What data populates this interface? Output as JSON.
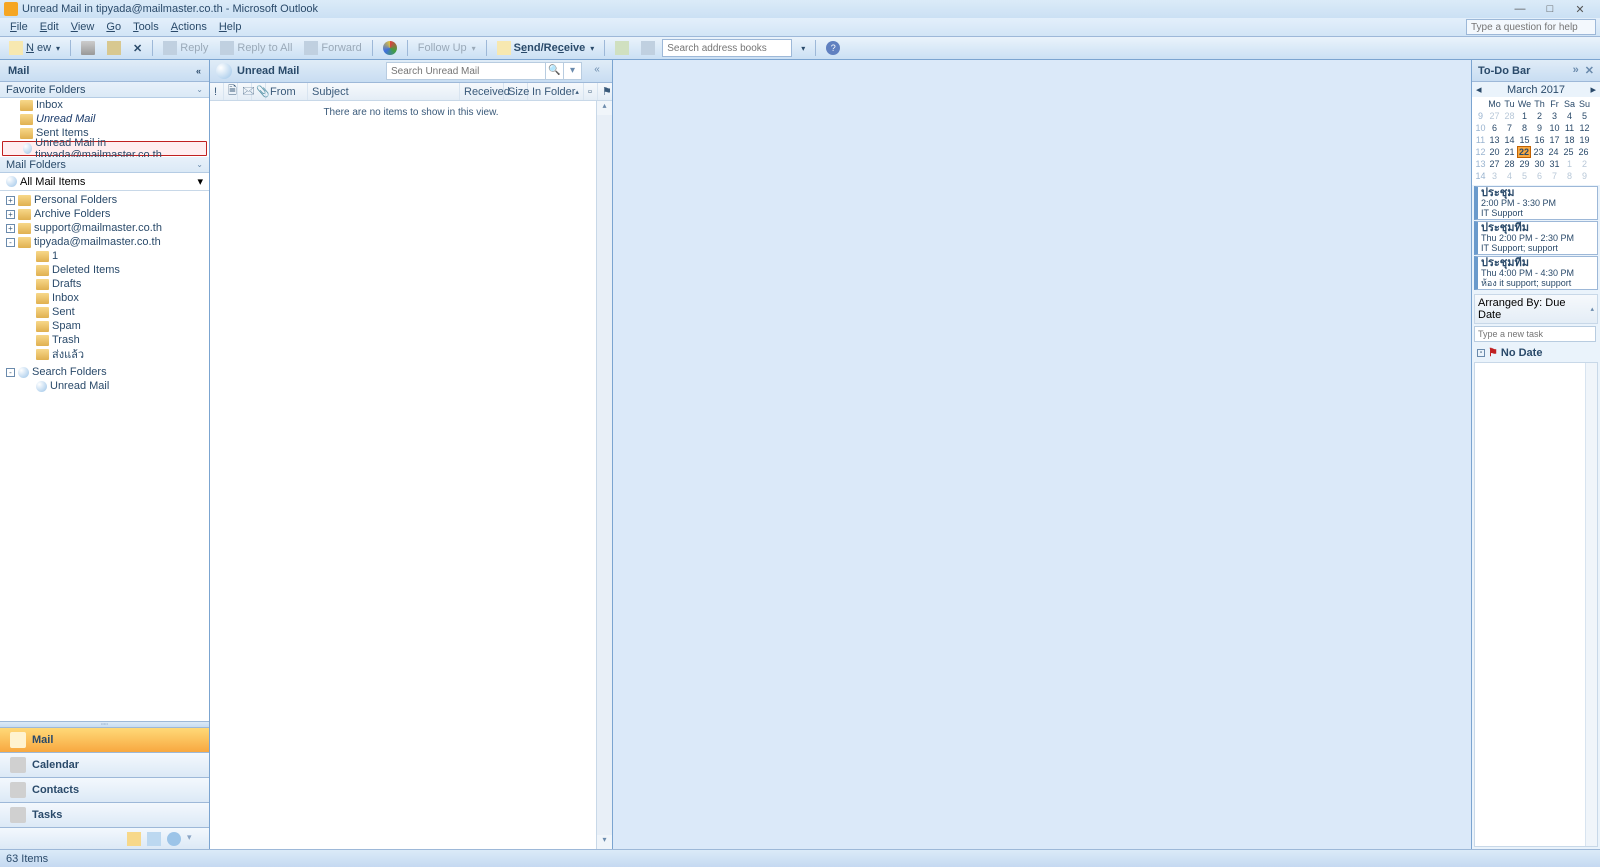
{
  "window": {
    "title": "Unread Mail in tipyada@mailmaster.co.th - Microsoft Outlook"
  },
  "menu": {
    "file": "File",
    "edit": "Edit",
    "view": "View",
    "go": "Go",
    "tools": "Tools",
    "actions": "Actions",
    "help": "Help",
    "help_placeholder": "Type a question for help"
  },
  "toolbar": {
    "new": "New",
    "reply": "Reply",
    "reply_all": "Reply to All",
    "forward": "Forward",
    "follow_up": "Follow Up",
    "send_receive": "Send/Receive",
    "search_placeholder": "Search address books"
  },
  "nav": {
    "title": "Mail",
    "fav_header": "Favorite Folders",
    "favorites": [
      {
        "label": "Inbox",
        "italic": false
      },
      {
        "label": "Unread Mail",
        "italic": true
      },
      {
        "label": "Sent Items",
        "italic": false
      },
      {
        "label": "Unread Mail in tipyada@mailmaster.co.th",
        "italic": false,
        "selected": true
      }
    ],
    "mail_folders_header": "Mail Folders",
    "all_mail": "All Mail Items",
    "tree": [
      {
        "label": "Personal Folders",
        "depth": 0,
        "exp": "+",
        "icon": "folder"
      },
      {
        "label": "Archive Folders",
        "depth": 0,
        "exp": "+",
        "icon": "folder"
      },
      {
        "label": "support@mailmaster.co.th",
        "depth": 0,
        "exp": "+",
        "icon": "folder"
      },
      {
        "label": "tipyada@mailmaster.co.th",
        "depth": 0,
        "exp": "-",
        "icon": "folder"
      },
      {
        "label": "1",
        "depth": 1,
        "icon": "folder"
      },
      {
        "label": "Deleted Items",
        "depth": 1,
        "icon": "folder"
      },
      {
        "label": "Drafts",
        "depth": 1,
        "icon": "folder"
      },
      {
        "label": "Inbox",
        "depth": 1,
        "icon": "folder"
      },
      {
        "label": "Sent",
        "depth": 1,
        "icon": "folder"
      },
      {
        "label": "Spam",
        "depth": 1,
        "icon": "folder"
      },
      {
        "label": "Trash",
        "depth": 1,
        "icon": "folder"
      },
      {
        "label": "ส่งแล้ว",
        "depth": 1,
        "icon": "folder"
      },
      {
        "label": "Search Folders",
        "depth": 0,
        "exp": "-",
        "icon": "search",
        "gap": true
      },
      {
        "label": "Unread Mail",
        "depth": 1,
        "icon": "search"
      }
    ],
    "buttons": [
      {
        "label": "Mail",
        "active": true
      },
      {
        "label": "Calendar",
        "active": false
      },
      {
        "label": "Contacts",
        "active": false
      },
      {
        "label": "Tasks",
        "active": false
      }
    ]
  },
  "list": {
    "title": "Unread Mail",
    "search_placeholder": "Search Unread Mail",
    "columns": {
      "from": "From",
      "subject": "Subject",
      "received": "Received",
      "size": "Size",
      "in_folder": "In Folder"
    },
    "empty": "There are no items to show in this view."
  },
  "todo": {
    "title": "To-Do Bar",
    "month": "March 2017",
    "days": [
      "Mo",
      "Tu",
      "We",
      "Th",
      "Fr",
      "Sa",
      "Su"
    ],
    "weeks": [
      {
        "wk": "9",
        "d": [
          "27",
          "28",
          "1",
          "2",
          "3",
          "4",
          "5"
        ],
        "other": [
          0,
          1
        ]
      },
      {
        "wk": "10",
        "d": [
          "6",
          "7",
          "8",
          "9",
          "10",
          "11",
          "12"
        ]
      },
      {
        "wk": "11",
        "d": [
          "13",
          "14",
          "15",
          "16",
          "17",
          "18",
          "19"
        ]
      },
      {
        "wk": "12",
        "d": [
          "20",
          "21",
          "22",
          "23",
          "24",
          "25",
          "26"
        ],
        "today": 2
      },
      {
        "wk": "13",
        "d": [
          "27",
          "28",
          "29",
          "30",
          "31",
          "1",
          "2"
        ],
        "other": [
          5,
          6
        ]
      },
      {
        "wk": "14",
        "d": [
          "3",
          "4",
          "5",
          "6",
          "7",
          "8",
          "9"
        ],
        "other": [
          0,
          1,
          2,
          3,
          4,
          5,
          6
        ]
      }
    ],
    "appts": [
      {
        "l1": "ประชุม",
        "l2": "2:00 PM - 3:30 PM",
        "l3": "IT Support"
      },
      {
        "l1": "ประชุมทีม",
        "l2": "Thu 2:00 PM - 2:30 PM",
        "l3": "IT Support; support"
      },
      {
        "l1": "ประชุมทีม",
        "l2": "Thu 4:00 PM - 4:30 PM",
        "l3": "ห้อง it support; support"
      }
    ],
    "arranged_by": "Arranged By: Due Date",
    "new_task": "Type a new task",
    "no_date": "No Date"
  },
  "status": {
    "text": "63 Items"
  }
}
